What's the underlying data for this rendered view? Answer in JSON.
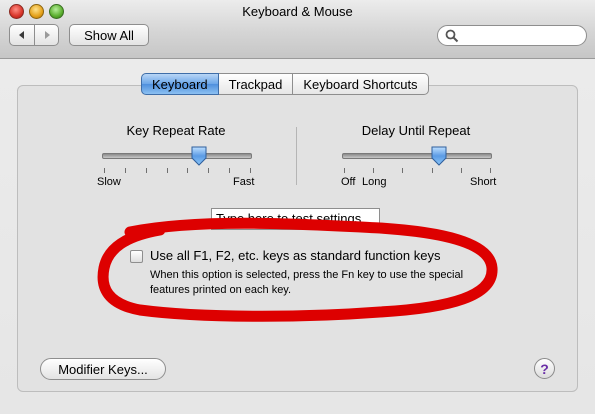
{
  "window": {
    "title": "Keyboard & Mouse"
  },
  "toolbar": {
    "back_icon": "chevron-left-icon",
    "forward_icon": "chevron-right-icon",
    "show_all_label": "Show All",
    "search_value": "",
    "search_placeholder": "",
    "search_icon": "magnifier-icon"
  },
  "tabs": [
    {
      "label": "Keyboard",
      "selected": true
    },
    {
      "label": "Trackpad",
      "selected": false
    },
    {
      "label": "Keyboard Shortcuts",
      "selected": false
    }
  ],
  "key_repeat": {
    "title": "Key Repeat Rate",
    "min_label": "Slow",
    "max_label": "Fast",
    "tick_count": 8,
    "value_fraction": 0.65
  },
  "delay_repeat": {
    "title": "Delay Until Repeat",
    "min_label": "Off",
    "min_label_2": "Long",
    "max_label": "Short",
    "tick_count": 6,
    "value_fraction": 0.65
  },
  "test_field": {
    "value": "Type here to test settings"
  },
  "function_keys": {
    "label": "Use all F1, F2, etc. keys as standard function keys",
    "description": "When this option is selected, press the Fn key to use the special features printed on each key.",
    "checked": false
  },
  "footer": {
    "modifier_keys_label": "Modifier Keys...",
    "help_label": "?"
  },
  "colors": {
    "annotation": "#dd0000",
    "tab_selected": "#5b9be4",
    "help_glyph": "#6b2fa7"
  }
}
